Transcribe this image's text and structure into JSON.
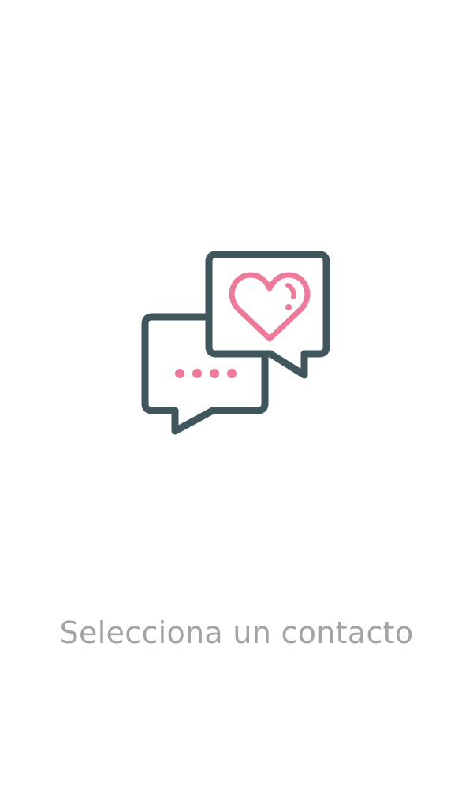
{
  "empty_state": {
    "message": "Selecciona un contacto",
    "illustration_icon": "chat-bubbles-heart-icon"
  },
  "colors": {
    "background": "#ffffff",
    "icon_stroke": "#3e565c",
    "icon_accent": "#f0799a",
    "message_text": "#a3a3a3"
  }
}
